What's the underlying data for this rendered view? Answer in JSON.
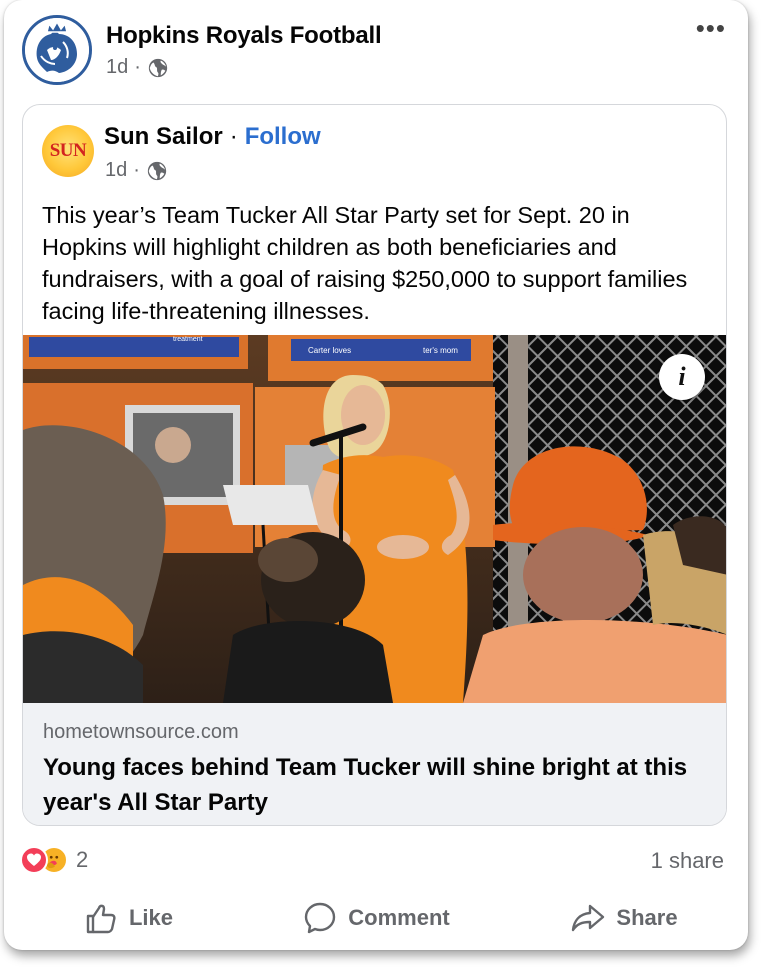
{
  "post": {
    "author": "Hopkins Royals Football",
    "time": "1d",
    "separator": "·",
    "more_label": "•••"
  },
  "shared": {
    "source": "Sun Sailor",
    "logo_text": "SUN",
    "separator": "·",
    "follow_label": "Follow",
    "time": "1d",
    "text": "This year’s Team Tucker All Star Party set for Sept. 20 in Hopkins will highlight children as both beneficiaries and fundraisers, with a goal of raising $250,000 to support families facing life-threatening illnesses.",
    "photo_signs": [
      "Carter loves",
      "ter's mom",
      "treatment"
    ],
    "info_label": "i",
    "link_domain": "hometownsource.com",
    "link_title": "Young faces behind Team Tucker will shine bright at this year's All Star Party"
  },
  "engagement": {
    "reaction_count": "2",
    "share_count": "1 share"
  },
  "actions": [
    {
      "label": "Like",
      "icon": "thumbs-up-icon"
    },
    {
      "label": "Comment",
      "icon": "comment-bubble-icon"
    },
    {
      "label": "Share",
      "icon": "share-arrow-icon"
    }
  ],
  "colors": {
    "accent_blue": "#2b6ecf",
    "secondary_text": "#65676b",
    "link_background": "#f0f2f5",
    "love_red": "#f33e58",
    "care_yellow": "#f7b125"
  }
}
